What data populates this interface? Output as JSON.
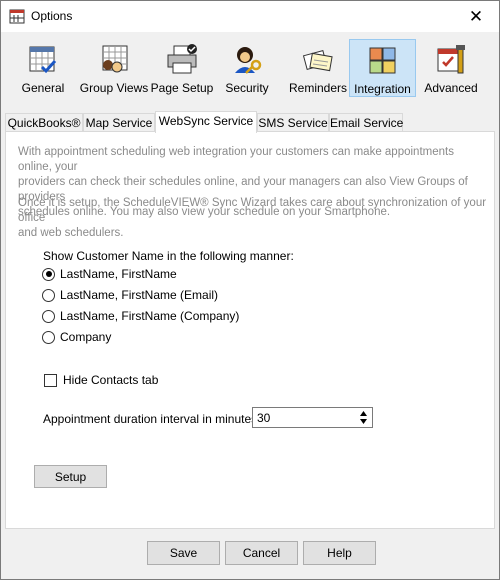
{
  "window": {
    "title": "Options",
    "close_glyph": "✕"
  },
  "toolbar": [
    {
      "id": "general",
      "label": "General",
      "icon": "calendar-check-icon"
    },
    {
      "id": "group-views",
      "label": "Group Views",
      "icon": "group-calendar-icon"
    },
    {
      "id": "page-setup",
      "label": "Page Setup",
      "icon": "printer-icon"
    },
    {
      "id": "security",
      "label": "Security",
      "icon": "user-key-icon"
    },
    {
      "id": "reminders",
      "label": "Reminders",
      "icon": "notes-icon"
    },
    {
      "id": "integration",
      "label": "Integration",
      "icon": "cubes-icon",
      "selected": true
    },
    {
      "id": "advanced",
      "label": "Advanced",
      "icon": "calendar-tools-icon"
    }
  ],
  "tabs": [
    {
      "label": "QuickBooks®"
    },
    {
      "label": "Map Service"
    },
    {
      "label": "WebSync Service",
      "active": true
    },
    {
      "label": "SMS Service"
    },
    {
      "label": "Email Service"
    }
  ],
  "panel": {
    "desc1": [
      "With appointment scheduling web integration your customers can make appointments online, your",
      "providers can check their schedules online, and your managers can also View Groups of providers",
      "schedules online. You may also view your schedule on your Smartphone."
    ],
    "desc2": [
      "Once it is setup, the ScheduleVIEW® Sync Wizard takes care about synchronization of your office",
      "and web schedulers."
    ],
    "name_label": "Show Customer Name in the following manner:",
    "name_options": [
      {
        "label": "LastName, FirstName",
        "checked": true
      },
      {
        "label": "LastName, FirstName (Email)",
        "checked": false
      },
      {
        "label": "LastName, FirstName (Company)",
        "checked": false
      },
      {
        "label": "Company",
        "checked": false
      }
    ],
    "hide_contacts_label": "Hide Contacts tab",
    "hide_contacts_checked": false,
    "duration_label": "Appointment duration interval in minutes:",
    "duration_value": "30",
    "setup_label": "Setup"
  },
  "footer": {
    "save_label": "Save",
    "cancel_label": "Cancel",
    "help_label": "Help"
  }
}
